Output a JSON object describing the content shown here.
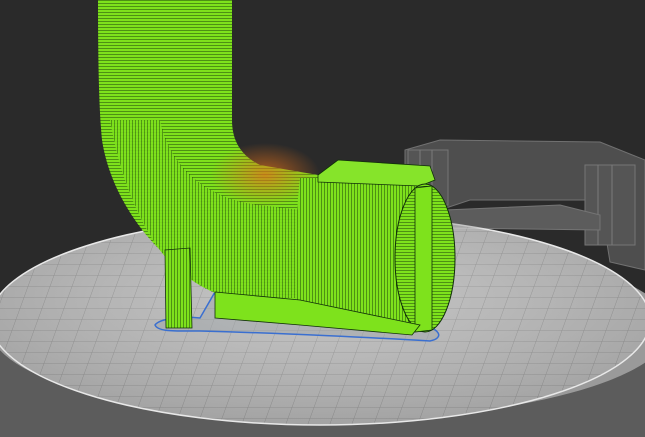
{
  "scene": {
    "type": "3d-slicer-layer-preview",
    "background_color": "#2a2a2a",
    "bed_color": "#bdbdbd",
    "bed_grid_color": "#8f8f8f",
    "model_color": "#7ee21c",
    "model_line_color": "#103008",
    "model_highlight_color": "#d86a1a",
    "outline_color": "#3a6fd0",
    "ghost_model_color": "#9a9a9a"
  }
}
